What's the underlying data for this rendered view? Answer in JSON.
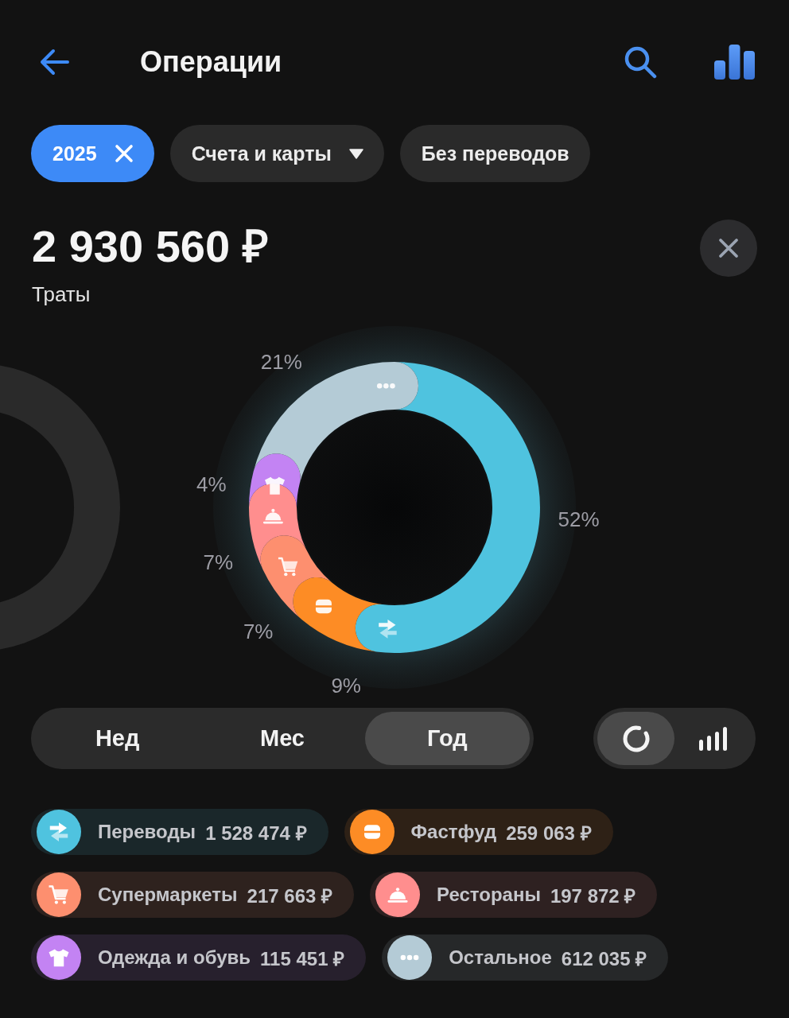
{
  "header": {
    "title": "Операции"
  },
  "filters": [
    {
      "label": "2025",
      "kind": "removable",
      "selected": true
    },
    {
      "label": "Счета и карты",
      "kind": "dropdown",
      "selected": false
    },
    {
      "label": "Без переводов",
      "kind": "plain",
      "selected": false
    }
  ],
  "summary": {
    "amount": "2 930 560 ₽",
    "caption": "Траты"
  },
  "chart": {
    "chart_data": {
      "type": "donut",
      "values": [
        52,
        9,
        7,
        7,
        4,
        21
      ],
      "value_labels": [
        "52%",
        "9%",
        "7%",
        "7%",
        "4%",
        "21%"
      ]
    }
  },
  "period_tabs": [
    {
      "label": "Нед",
      "selected": false
    },
    {
      "label": "Мес",
      "selected": false
    },
    {
      "label": "Год",
      "selected": true
    }
  ],
  "chart_types": [
    {
      "kind": "donut",
      "selected": true
    },
    {
      "kind": "bars",
      "selected": false
    }
  ],
  "categories": [
    {
      "kind": "transfer",
      "name": "Переводы",
      "amount": "1 528 474 ₽",
      "color": "#4fc3df"
    },
    {
      "kind": "fastfood",
      "name": "Фастфуд",
      "amount": "259 063 ₽",
      "color": "#fd8c25"
    },
    {
      "kind": "cart",
      "name": "Супермаркеты",
      "amount": "217 663 ₽",
      "color": "#fd8f6f"
    },
    {
      "kind": "cloche",
      "name": "Рестораны",
      "amount": "197 872 ₽",
      "color": "#ff8e8e"
    },
    {
      "kind": "tshirt",
      "name": "Одежда и обувь",
      "amount": "115 451 ₽",
      "color": "#c383f3"
    },
    {
      "kind": "dots",
      "name": "Остальное",
      "amount": "612 035 ₽",
      "color": "#b4cbd6"
    }
  ]
}
